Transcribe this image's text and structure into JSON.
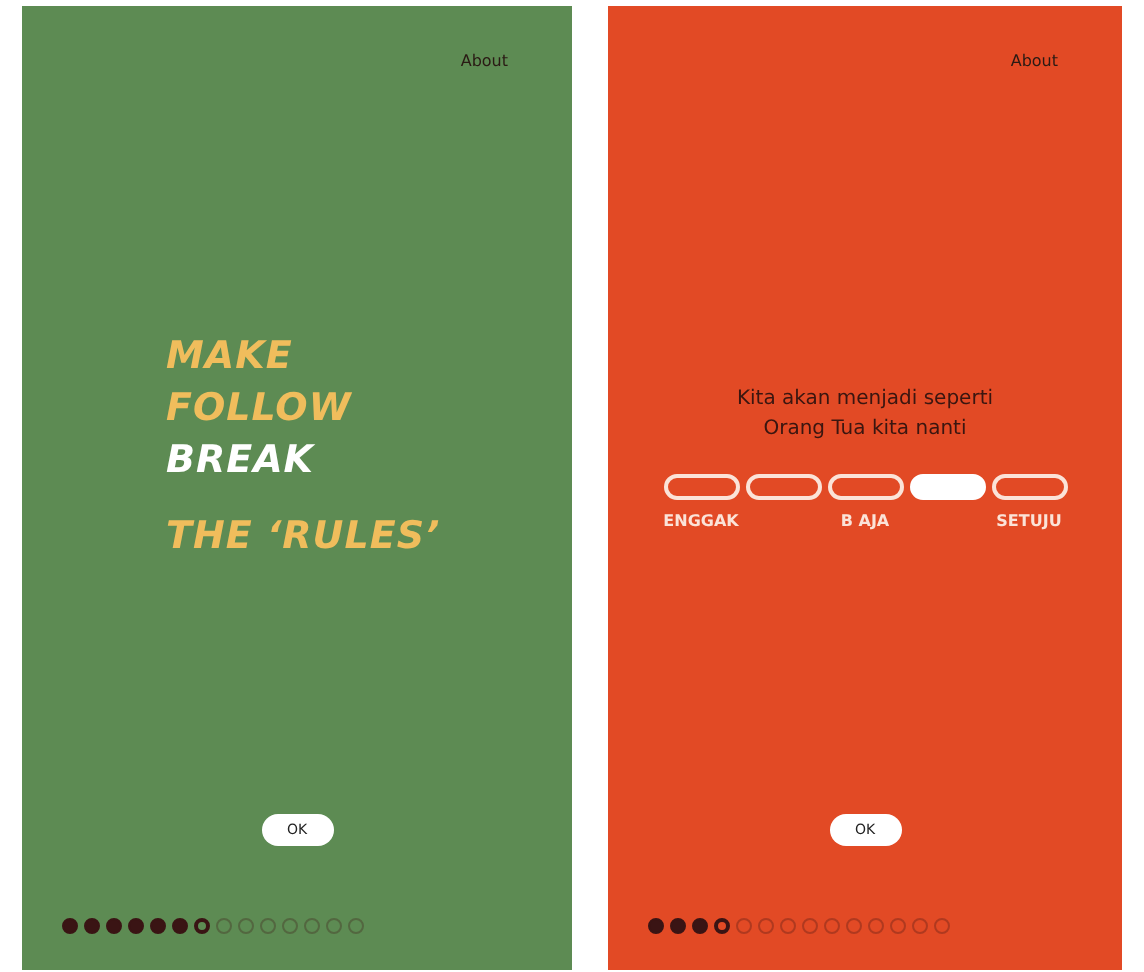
{
  "screens": [
    {
      "kind": "headline",
      "about": "About",
      "lines": [
        {
          "text": "MAKE",
          "color": "#f0bd5c"
        },
        {
          "text": "FOLLOW",
          "color": "#f0bd5c"
        },
        {
          "text": "BREAK",
          "color": "#ffffff"
        },
        {
          "text": "THE ‘RULES’",
          "color": "#f0bd5c"
        }
      ],
      "ok": "OK",
      "dots": [
        {
          "kind": "done"
        },
        {
          "kind": "done"
        },
        {
          "kind": "done"
        },
        {
          "kind": "done"
        },
        {
          "kind": "done"
        },
        {
          "kind": "done"
        },
        {
          "kind": "current"
        },
        {
          "kind": "todo"
        },
        {
          "kind": "todo"
        },
        {
          "kind": "todo"
        },
        {
          "kind": "todo"
        },
        {
          "kind": "todo"
        },
        {
          "kind": "todo"
        },
        {
          "kind": "todo"
        }
      ]
    },
    {
      "kind": "question",
      "about": "About",
      "question": "Kita akan menjadi seperti Orang Tua kita nanti",
      "options": [
        {
          "label": "ENGGAK",
          "selected": false
        },
        {
          "selected": false
        },
        {
          "label": "B AJA",
          "selected": false
        },
        {
          "selected": true
        },
        {
          "label": "SETUJU",
          "selected": false
        }
      ],
      "ok": "OK",
      "dots": [
        {
          "kind": "done"
        },
        {
          "kind": "done"
        },
        {
          "kind": "done"
        },
        {
          "kind": "current"
        },
        {
          "kind": "todo"
        },
        {
          "kind": "todo"
        },
        {
          "kind": "todo"
        },
        {
          "kind": "todo"
        },
        {
          "kind": "todo"
        },
        {
          "kind": "todo"
        },
        {
          "kind": "todo"
        },
        {
          "kind": "todo"
        },
        {
          "kind": "todo"
        },
        {
          "kind": "todo"
        }
      ]
    }
  ]
}
